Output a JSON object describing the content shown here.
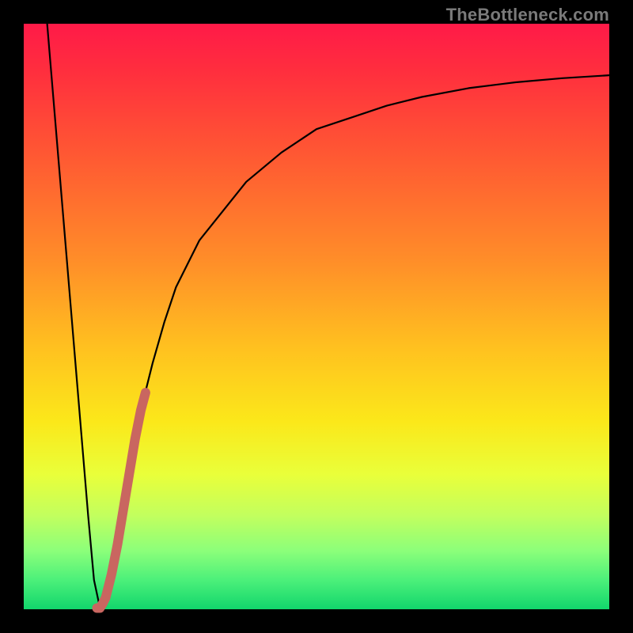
{
  "watermark": {
    "text": "TheBottleneck.com"
  },
  "chart_data": {
    "type": "line",
    "title": "",
    "xlabel": "",
    "ylabel": "",
    "xlim": [
      0,
      100
    ],
    "ylim": [
      0,
      100
    ],
    "grid": false,
    "legend": false,
    "series": [
      {
        "name": "black-curve",
        "color": "#000000",
        "x": [
          4,
          5,
          6,
          7,
          8,
          9,
          10,
          11,
          12,
          13,
          14,
          15,
          16,
          17,
          18,
          19,
          20,
          22,
          24,
          26,
          28,
          30,
          34,
          38,
          44,
          50,
          56,
          62,
          68,
          76,
          84,
          92,
          100
        ],
        "y": [
          100,
          88,
          76,
          64,
          52,
          40,
          28,
          16,
          5,
          0.3,
          2,
          6,
          11,
          17,
          23,
          29,
          34,
          42,
          49,
          55,
          59,
          63,
          68,
          73,
          78,
          82,
          84,
          86,
          87.5,
          89,
          90,
          90.7,
          91.2
        ]
      },
      {
        "name": "pink-highlight",
        "color": "#c96660",
        "x": [
          12.5,
          13,
          13.5,
          14,
          15,
          16,
          17,
          18,
          19,
          20,
          20.8
        ],
        "y": [
          0.2,
          0.2,
          1,
          2,
          6,
          11,
          17,
          23,
          29,
          34,
          37
        ]
      }
    ]
  }
}
